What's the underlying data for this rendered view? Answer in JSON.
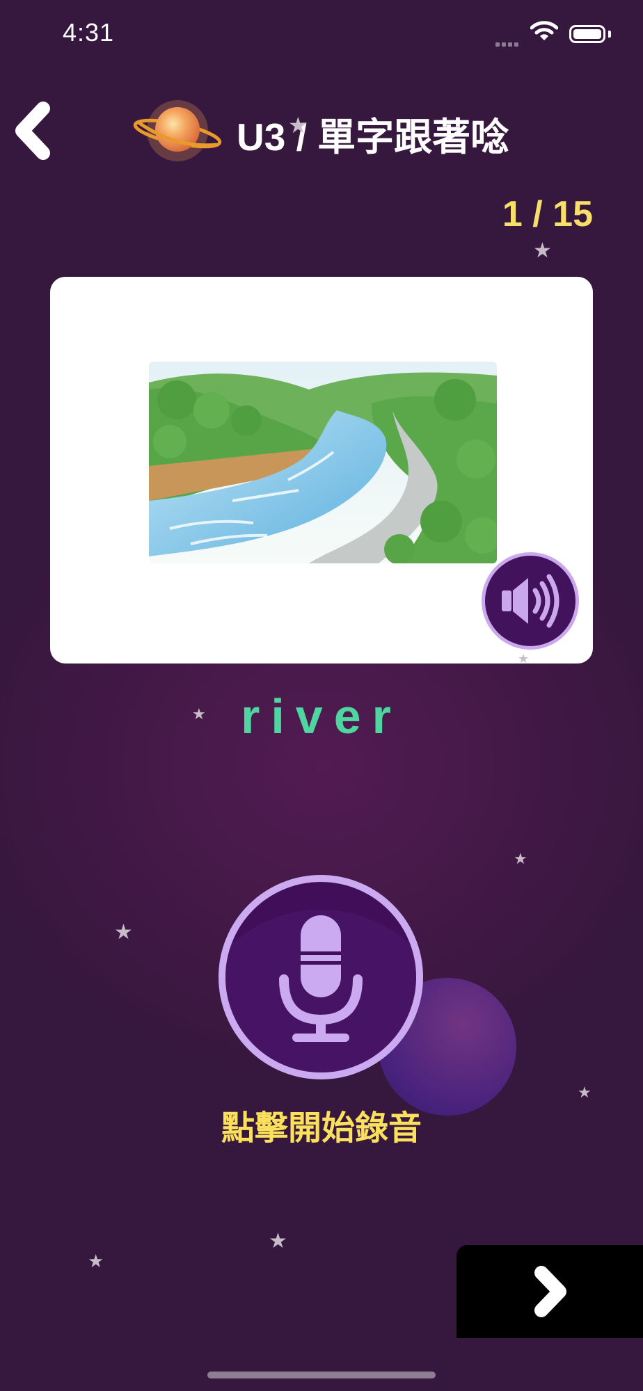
{
  "status_bar": {
    "time": "4:31"
  },
  "header": {
    "title": "U3 / 單字跟著唸",
    "progress": "1 / 15"
  },
  "card": {
    "word": "river",
    "illustration": "river-illustration",
    "sound_icon": "speaker-icon"
  },
  "recorder": {
    "hint": "點擊開始錄音",
    "icon": "microphone-icon"
  },
  "nav": {
    "back_icon": "chevron-left-icon",
    "next_icon": "chevron-right-icon"
  },
  "colors": {
    "background": "#36173d",
    "accent_yellow": "#f8de6a",
    "word_green": "#4fd6a0",
    "button_purple": "#410f5a",
    "button_ring": "#cbaaf2"
  }
}
